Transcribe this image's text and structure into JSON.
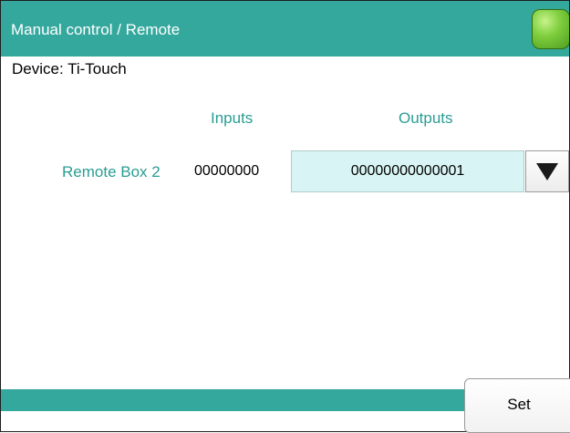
{
  "window": {
    "title": "Manual control / Remote",
    "status_indicator_color": "#7fcf3e"
  },
  "device": {
    "label": "Device: Ti-Touch"
  },
  "table": {
    "headers": {
      "inputs": "Inputs",
      "outputs": "Outputs"
    },
    "rows": [
      {
        "label": "Remote Box 2",
        "inputs": "00000000",
        "outputs": "00000000000001"
      }
    ]
  },
  "dropdown": {
    "icon": "triangle-down-icon"
  },
  "footer": {
    "set_label": "Set"
  },
  "colors": {
    "accent": "#35a89e",
    "label_text": "#2a9d93",
    "field_background": "#d9f4f4"
  }
}
